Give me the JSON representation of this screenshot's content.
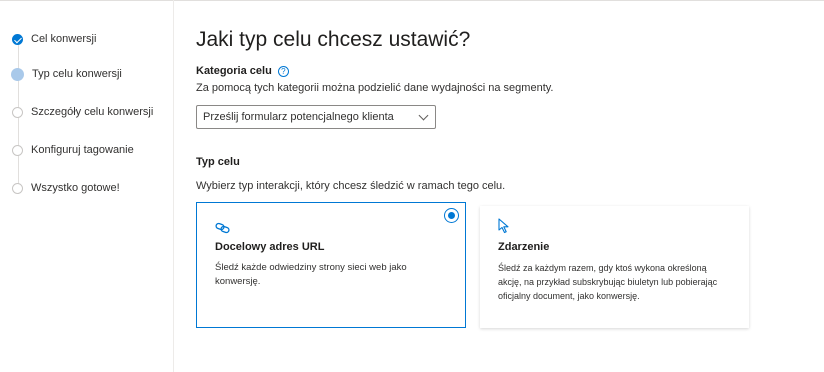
{
  "sidebar": {
    "steps": [
      {
        "label": "Cel konwersji",
        "state": "done"
      },
      {
        "label": "Typ celu konwersji",
        "state": "current"
      },
      {
        "label": "Szczegóły celu konwersji",
        "state": "pending"
      },
      {
        "label": "Konfiguruj tagowanie",
        "state": "pending"
      },
      {
        "label": "Wszystko gotowe!",
        "state": "pending"
      }
    ]
  },
  "main": {
    "title": "Jaki typ celu chcesz ustawić?",
    "category": {
      "label": "Kategoria celu",
      "help_icon": "?",
      "description": "Za pomocą tych kategorii można podzielić dane wydajności na segmenty.",
      "selected_value": "Prześlij formularz potencjalnego klienta"
    },
    "goal_type": {
      "label": "Typ celu",
      "description": "Wybierz typ interakcji, który chcesz śledzić w ramach tego celu.",
      "options": [
        {
          "title": "Docelowy adres URL",
          "description": "Śledź każde odwiedziny strony sieci web jako konwersję.",
          "selected": true,
          "icon": "link-icon"
        },
        {
          "title": "Zdarzenie",
          "description": "Śledź za każdym razem, gdy ktoś wykona określoną akcję, na przykład subskrybując biuletyn lub pobierając oficjalny document, jako konwersję.",
          "selected": false,
          "icon": "cursor-icon"
        }
      ]
    }
  },
  "colors": {
    "accent": "#0078d4",
    "current_step": "#a9c9ea",
    "border": "#e1dfdd"
  }
}
